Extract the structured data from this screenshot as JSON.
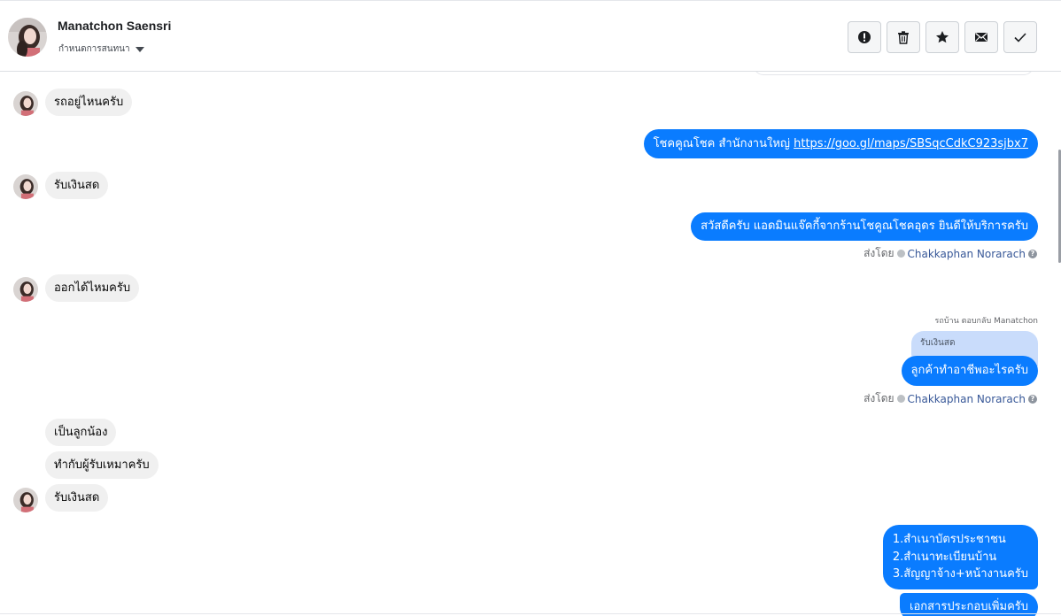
{
  "header": {
    "contact_name": "Manatchon Saensri",
    "conversation_menu_label": "กำหนดการสนทนา",
    "toolbar": [
      {
        "name": "report-spam-button",
        "icon": "exclamation-icon"
      },
      {
        "name": "delete-button",
        "icon": "trash-icon"
      },
      {
        "name": "star-button",
        "icon": "star-icon"
      },
      {
        "name": "mark-unread-button",
        "icon": "envelope-icon"
      },
      {
        "name": "mark-done-button",
        "icon": "check-icon"
      }
    ]
  },
  "messages": {
    "m1": "รถอยู่ไหนครับ",
    "m2_text": "โชคคูณโชค สำนักงานใหญ่ ",
    "m2_link": "https://goo.gl/maps/SBSqcCdkC923sjbx7",
    "m3": "รับเงินสด",
    "m4": "สวัสดีครับ แอดมินแจ๊คกี้จากร้านโชคูณโชคอุดร ยินดีให้บริการครับ",
    "m5": "ออกได้ไหมครับ",
    "reply_note": "รถบ้าน ตอบกลับ Manatchon",
    "quoted": "รับเงินสด",
    "m6": "ลูกค้าทำอาชีพอะไรครับ",
    "m7": "เป็นลูกน้อง",
    "m8": "ทำกับผู้รับเหมาครับ",
    "m9": "รับเงินสด",
    "m10_l1": "1.สำเนาบัตรประชาชน",
    "m10_l2": "2.สำเนาทะเบียนบ้าน",
    "m10_l3": "3.สัญญาจ้าง+หน้างานครับ",
    "m11_partial": "เอกสารประกอบเพิ่มครับ"
  },
  "sent_by": {
    "prefix": "ส่งโดย",
    "agent": "Chakkaphan Norarach",
    "help": "?"
  },
  "colors": {
    "outgoing_bubble": "#0a7cff",
    "incoming_bubble": "#f0f0f0",
    "agent_link": "#385898"
  }
}
